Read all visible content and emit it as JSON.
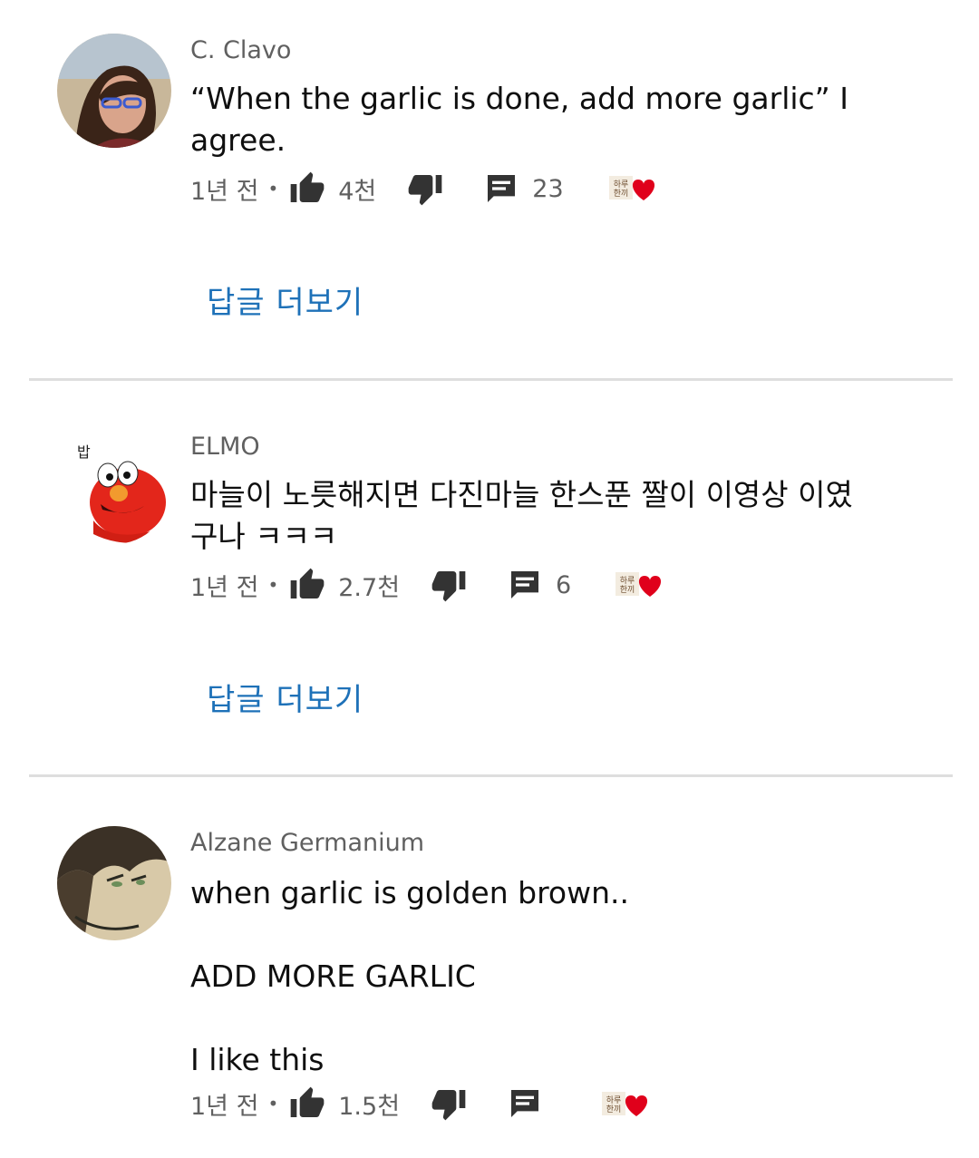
{
  "replies_label": "답글 더보기",
  "comments": [
    {
      "author": "C. Clavo",
      "text": "“When the garlic is done, add more garlic” I\nagree.",
      "age": "1년 전",
      "likes": "4천",
      "reply_count": "23",
      "badge_text": "하루\n한끼"
    },
    {
      "author": "ELMO",
      "text": "마늘이 노릇해지면 다진마늘 한스푼 짤이 이영상 이였\n구나 ㅋㅋㅋ",
      "age": "1년 전",
      "likes": "2.7천",
      "reply_count": "6",
      "badge_text": "하루\n한끼",
      "avatar_caption": "밥"
    },
    {
      "author": "Alzane Germanium",
      "text": "when garlic is golden brown..\n\nADD MORE GARLIC\n\nI like this",
      "age": "1년 전",
      "likes": "1.5천",
      "reply_count": "",
      "badge_text": "하루\n한끼"
    }
  ],
  "icons": {
    "like": "thumbs-up-icon",
    "dislike": "thumbs-down-icon",
    "reply": "comment-icon",
    "heart": "heart-icon"
  },
  "colors": {
    "link": "#1e71b8",
    "meta": "#606060",
    "heart": "#e0001b",
    "divider": "#dedede"
  }
}
